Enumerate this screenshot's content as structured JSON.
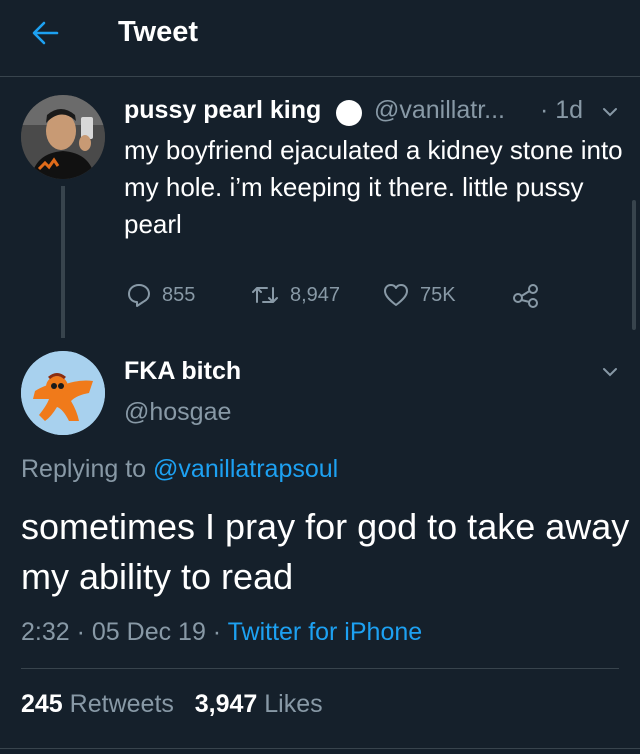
{
  "header": {
    "title": "Tweet"
  },
  "parent_tweet": {
    "display_name": "pussy pearl king",
    "handle": "@vanillatr...",
    "time": "· 1d",
    "text": "my boyfriend ejaculated a kidney stone into my hole. i’m keeping it there. little pussy pearl",
    "replies": "855",
    "retweets": "8,947",
    "likes": "75K"
  },
  "reply_tweet": {
    "display_name": "FKA bitch",
    "handle": "@hosgae",
    "replying_prefix": "Replying to",
    "replying_to": "@vanillatrapsoul",
    "text": "sometimes I pray for god to take away my ability to read",
    "time": "2:32",
    "date": "05 Dec 19",
    "source": "Twitter for iPhone",
    "retweet_count": "245",
    "retweet_label": "Retweets",
    "like_count": "3,947",
    "like_label": "Likes"
  },
  "colors": {
    "background": "#15202b",
    "accent": "#1da1f2",
    "muted": "#8899a6",
    "divider": "#38444d"
  },
  "icons": [
    "back-arrow-icon",
    "reply-icon",
    "retweet-icon",
    "heart-icon",
    "share-icon",
    "chevron-down-icon"
  ]
}
